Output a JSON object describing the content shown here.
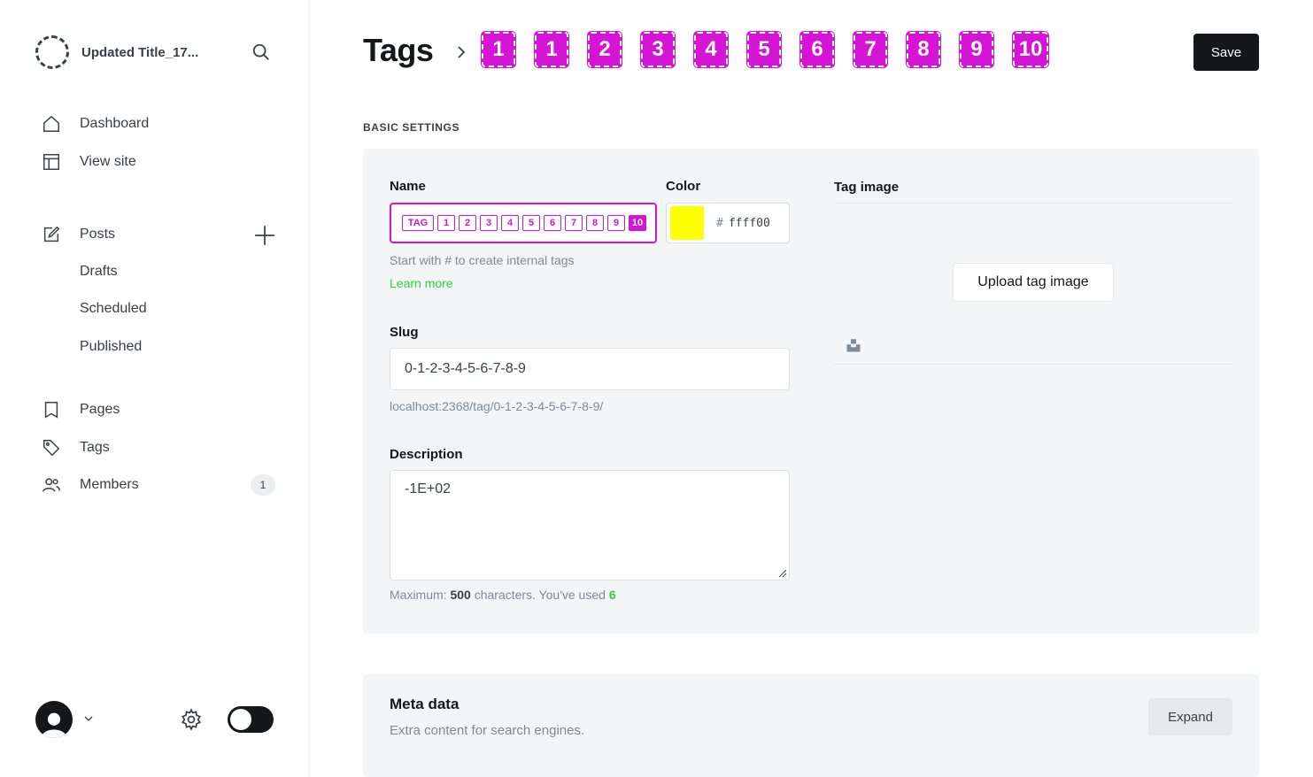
{
  "sidebar": {
    "site_title": "Updated Title_17...",
    "nav": {
      "dashboard": "Dashboard",
      "view_site": "View site",
      "posts": "Posts",
      "drafts": "Drafts",
      "scheduled": "Scheduled",
      "published": "Published",
      "pages": "Pages",
      "tags": "Tags",
      "members": "Members",
      "members_count": "1"
    }
  },
  "header": {
    "section": "Tags",
    "tag_chips": [
      "1",
      "1",
      "2",
      "3",
      "4",
      "5",
      "6",
      "7",
      "8",
      "9",
      "10"
    ],
    "save_label": "Save"
  },
  "basic": {
    "section_label": "BASIC SETTINGS",
    "name_label": "Name",
    "name_chips": [
      "TAG",
      "1",
      "2",
      "3",
      "4",
      "5",
      "6",
      "7",
      "8",
      "9",
      "10"
    ],
    "color_label": "Color",
    "color_hash": "#",
    "color_value": "ffff00",
    "color_hex": "#ffff00",
    "name_hint": "Start with # to create internal tags",
    "learn_more": "Learn more",
    "slug_label": "Slug",
    "slug_value": "0-1-2-3-4-5-6-7-8-9",
    "slug_url": "localhost:2368/tag/0-1-2-3-4-5-6-7-8-9/",
    "description_label": "Description",
    "description_value": "-1E+02",
    "count_prefix": "Maximum:",
    "count_max": "500",
    "count_mid": "characters. You've used",
    "count_used": "6",
    "tag_image_label": "Tag image",
    "upload_label": "Upload tag image"
  },
  "meta": {
    "title": "Meta data",
    "subtitle": "Extra content for search engines.",
    "expand_label": "Expand"
  },
  "colors": {
    "accent_green": "#30cf43",
    "highlight_magenta": "#d614d6",
    "text_dark": "#15171a"
  }
}
